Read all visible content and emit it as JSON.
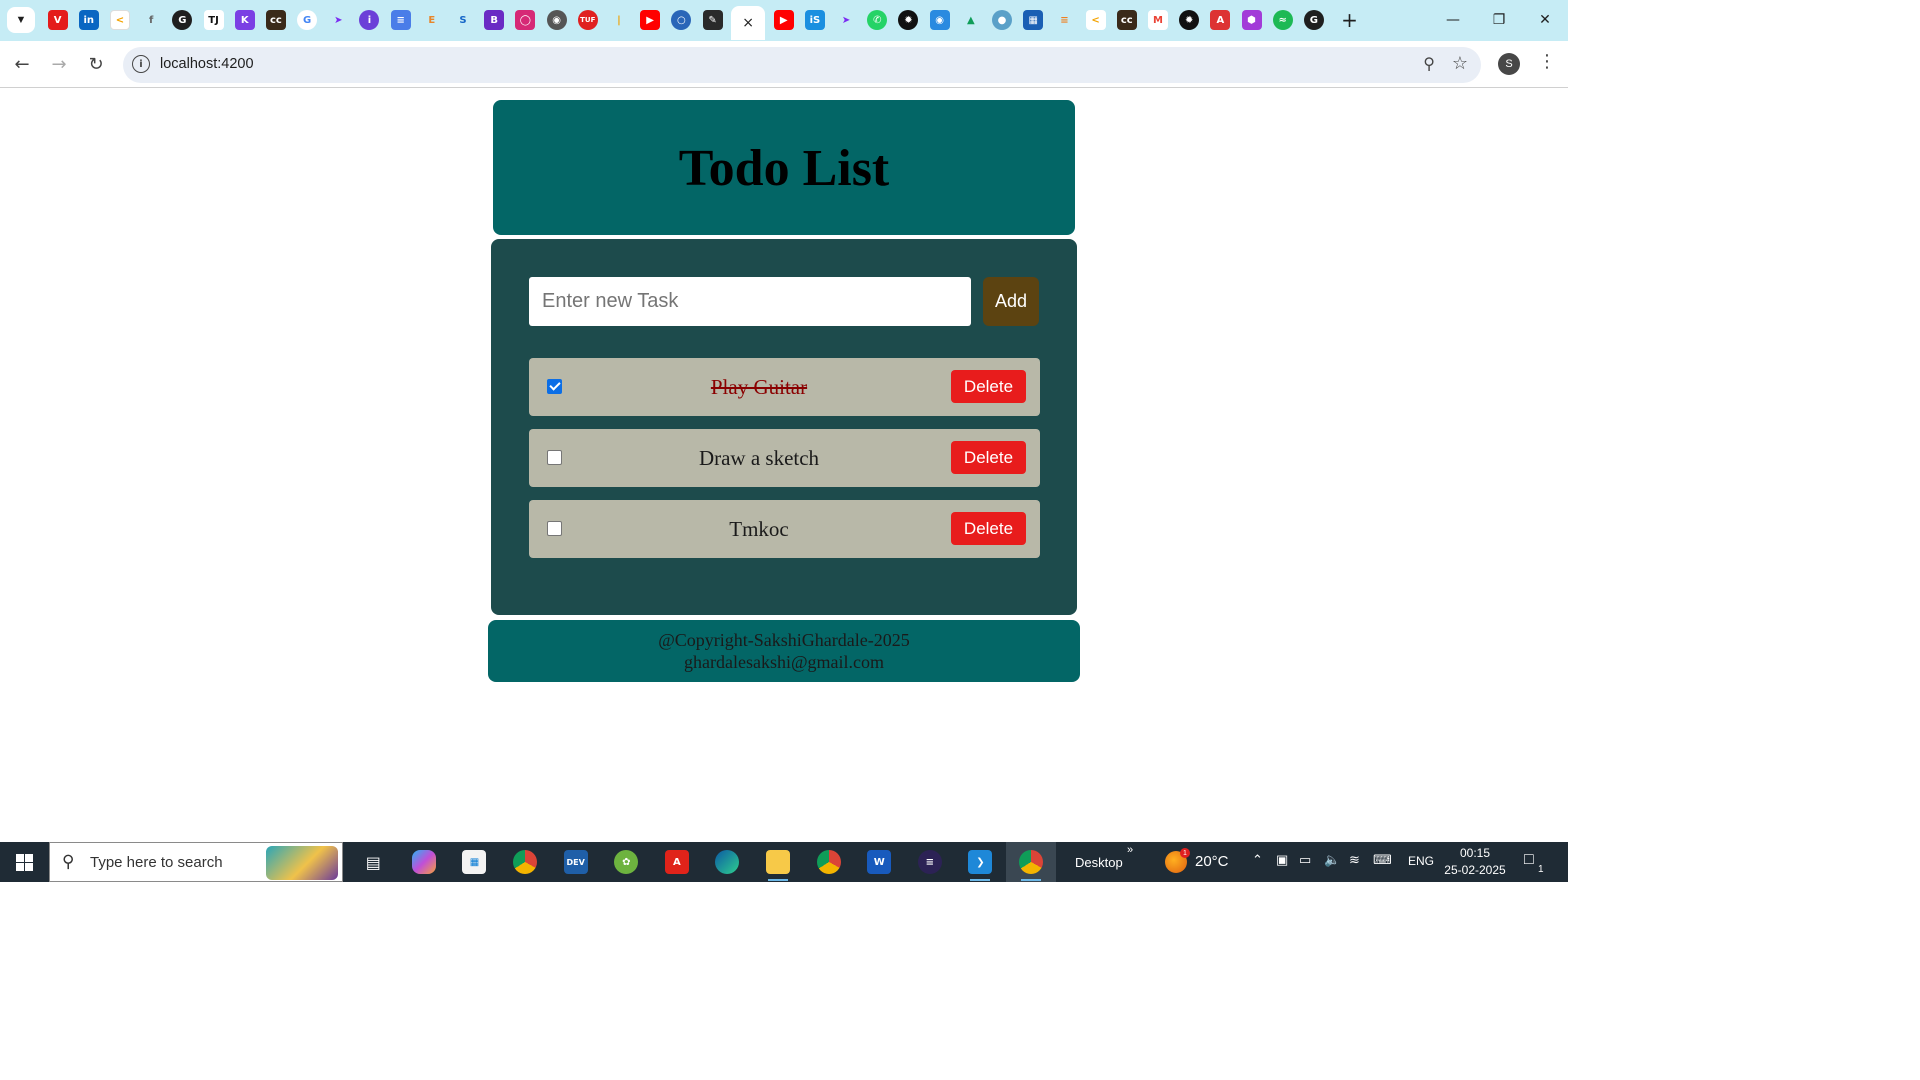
{
  "browser": {
    "url": "localhost:4200",
    "profile_initial": "S",
    "tab_menu_icon": "chevron-down-icon",
    "close_tab_glyph": "×",
    "new_tab_glyph": "+"
  },
  "page": {
    "title": "Todo List",
    "input_placeholder": "Enter new Task",
    "input_value": "",
    "add_label": "Add",
    "delete_label": "Delete",
    "tasks": [
      {
        "title": "Play Guitar",
        "completed": true
      },
      {
        "title": "Draw a sketch",
        "completed": false
      },
      {
        "title": "Tmkoc",
        "completed": false
      }
    ],
    "footer": {
      "copyright": "@Copyright-SakshiGhardale-2025",
      "email": "ghardalesakshi@gmail.com"
    },
    "colors": {
      "header_bg": "#036666",
      "panel_bg": "#1d4b4c",
      "task_bg": "#b8b8a8",
      "add_button": "#5c4311",
      "delete_button": "#e81c1c",
      "done_text": "#8a0000"
    }
  },
  "taskbar": {
    "search_placeholder": "Type here to search",
    "desktop_label": "Desktop",
    "weather": "20°C",
    "weather_badge": "1",
    "language": "ENG",
    "time": "00:15",
    "date": "25-02-2025",
    "notification_count": "1"
  }
}
